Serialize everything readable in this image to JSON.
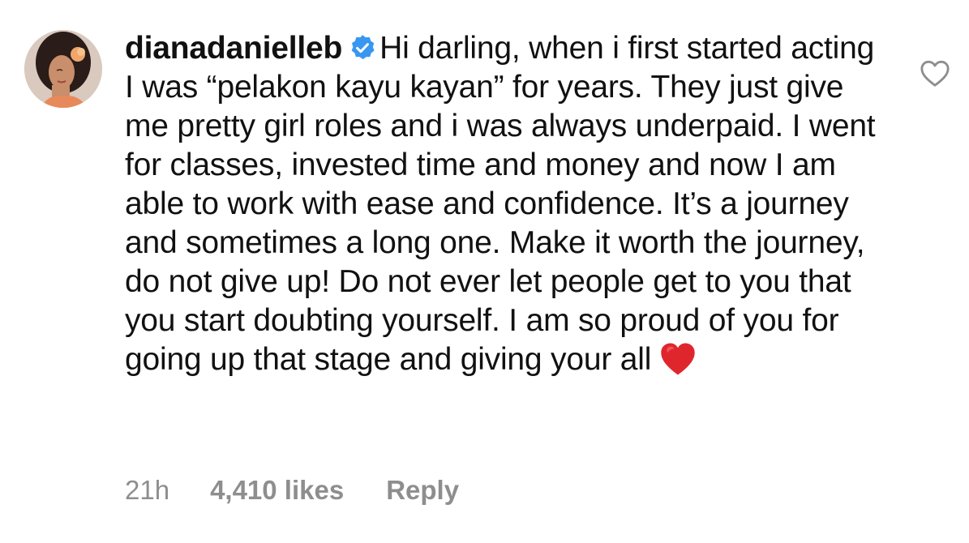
{
  "comment": {
    "username": "dianadanielleb",
    "verified": true,
    "text": "Hi darling, when i first started acting I was “pelakon kayu kayan” for years. They just give me pretty girl roles and i was always underpaid. I went for classes, invested time and money and now I am able to work with ease and confidence. It’s a journey and sometimes a long one. Make it worth the journey, do not give up! Do not ever let people get to you that you start doubting yourself. I am so proud of you for going up that stage and giving your all",
    "emoji": "red-heart",
    "time": "21h",
    "likes": "4,410 likes",
    "reply_label": "Reply"
  },
  "icons": {
    "verified": "verified-badge-icon",
    "like": "heart-outline-icon"
  },
  "colors": {
    "verified_blue": "#3897f0",
    "meta_gray": "#8e8e8e",
    "heart_red": "#e0262d"
  }
}
